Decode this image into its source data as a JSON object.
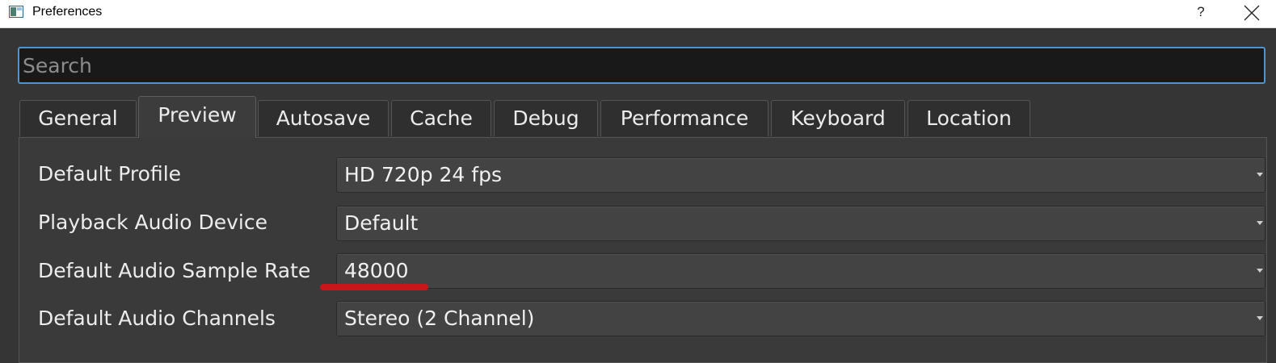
{
  "window": {
    "title": "Preferences",
    "help_label": "?"
  },
  "search": {
    "placeholder": "Search",
    "value": ""
  },
  "tabs": [
    {
      "label": "General"
    },
    {
      "label": "Preview"
    },
    {
      "label": "Autosave"
    },
    {
      "label": "Cache"
    },
    {
      "label": "Debug"
    },
    {
      "label": "Performance"
    },
    {
      "label": "Keyboard"
    },
    {
      "label": "Location"
    }
  ],
  "active_tab": "Preview",
  "settings": [
    {
      "label": "Default Profile",
      "value": "HD 720p 24 fps"
    },
    {
      "label": "Playback Audio Device",
      "value": "Default"
    },
    {
      "label": "Default Audio Sample Rate",
      "value": "48000"
    },
    {
      "label": "Default Audio Channels",
      "value": "Stereo (2 Channel)"
    }
  ],
  "colors": {
    "accent": "#4e94cf",
    "background": "#353535",
    "annotation": "#c8161b"
  },
  "icons": [
    "app-icon",
    "close-icon",
    "chevron-down-icon"
  ]
}
